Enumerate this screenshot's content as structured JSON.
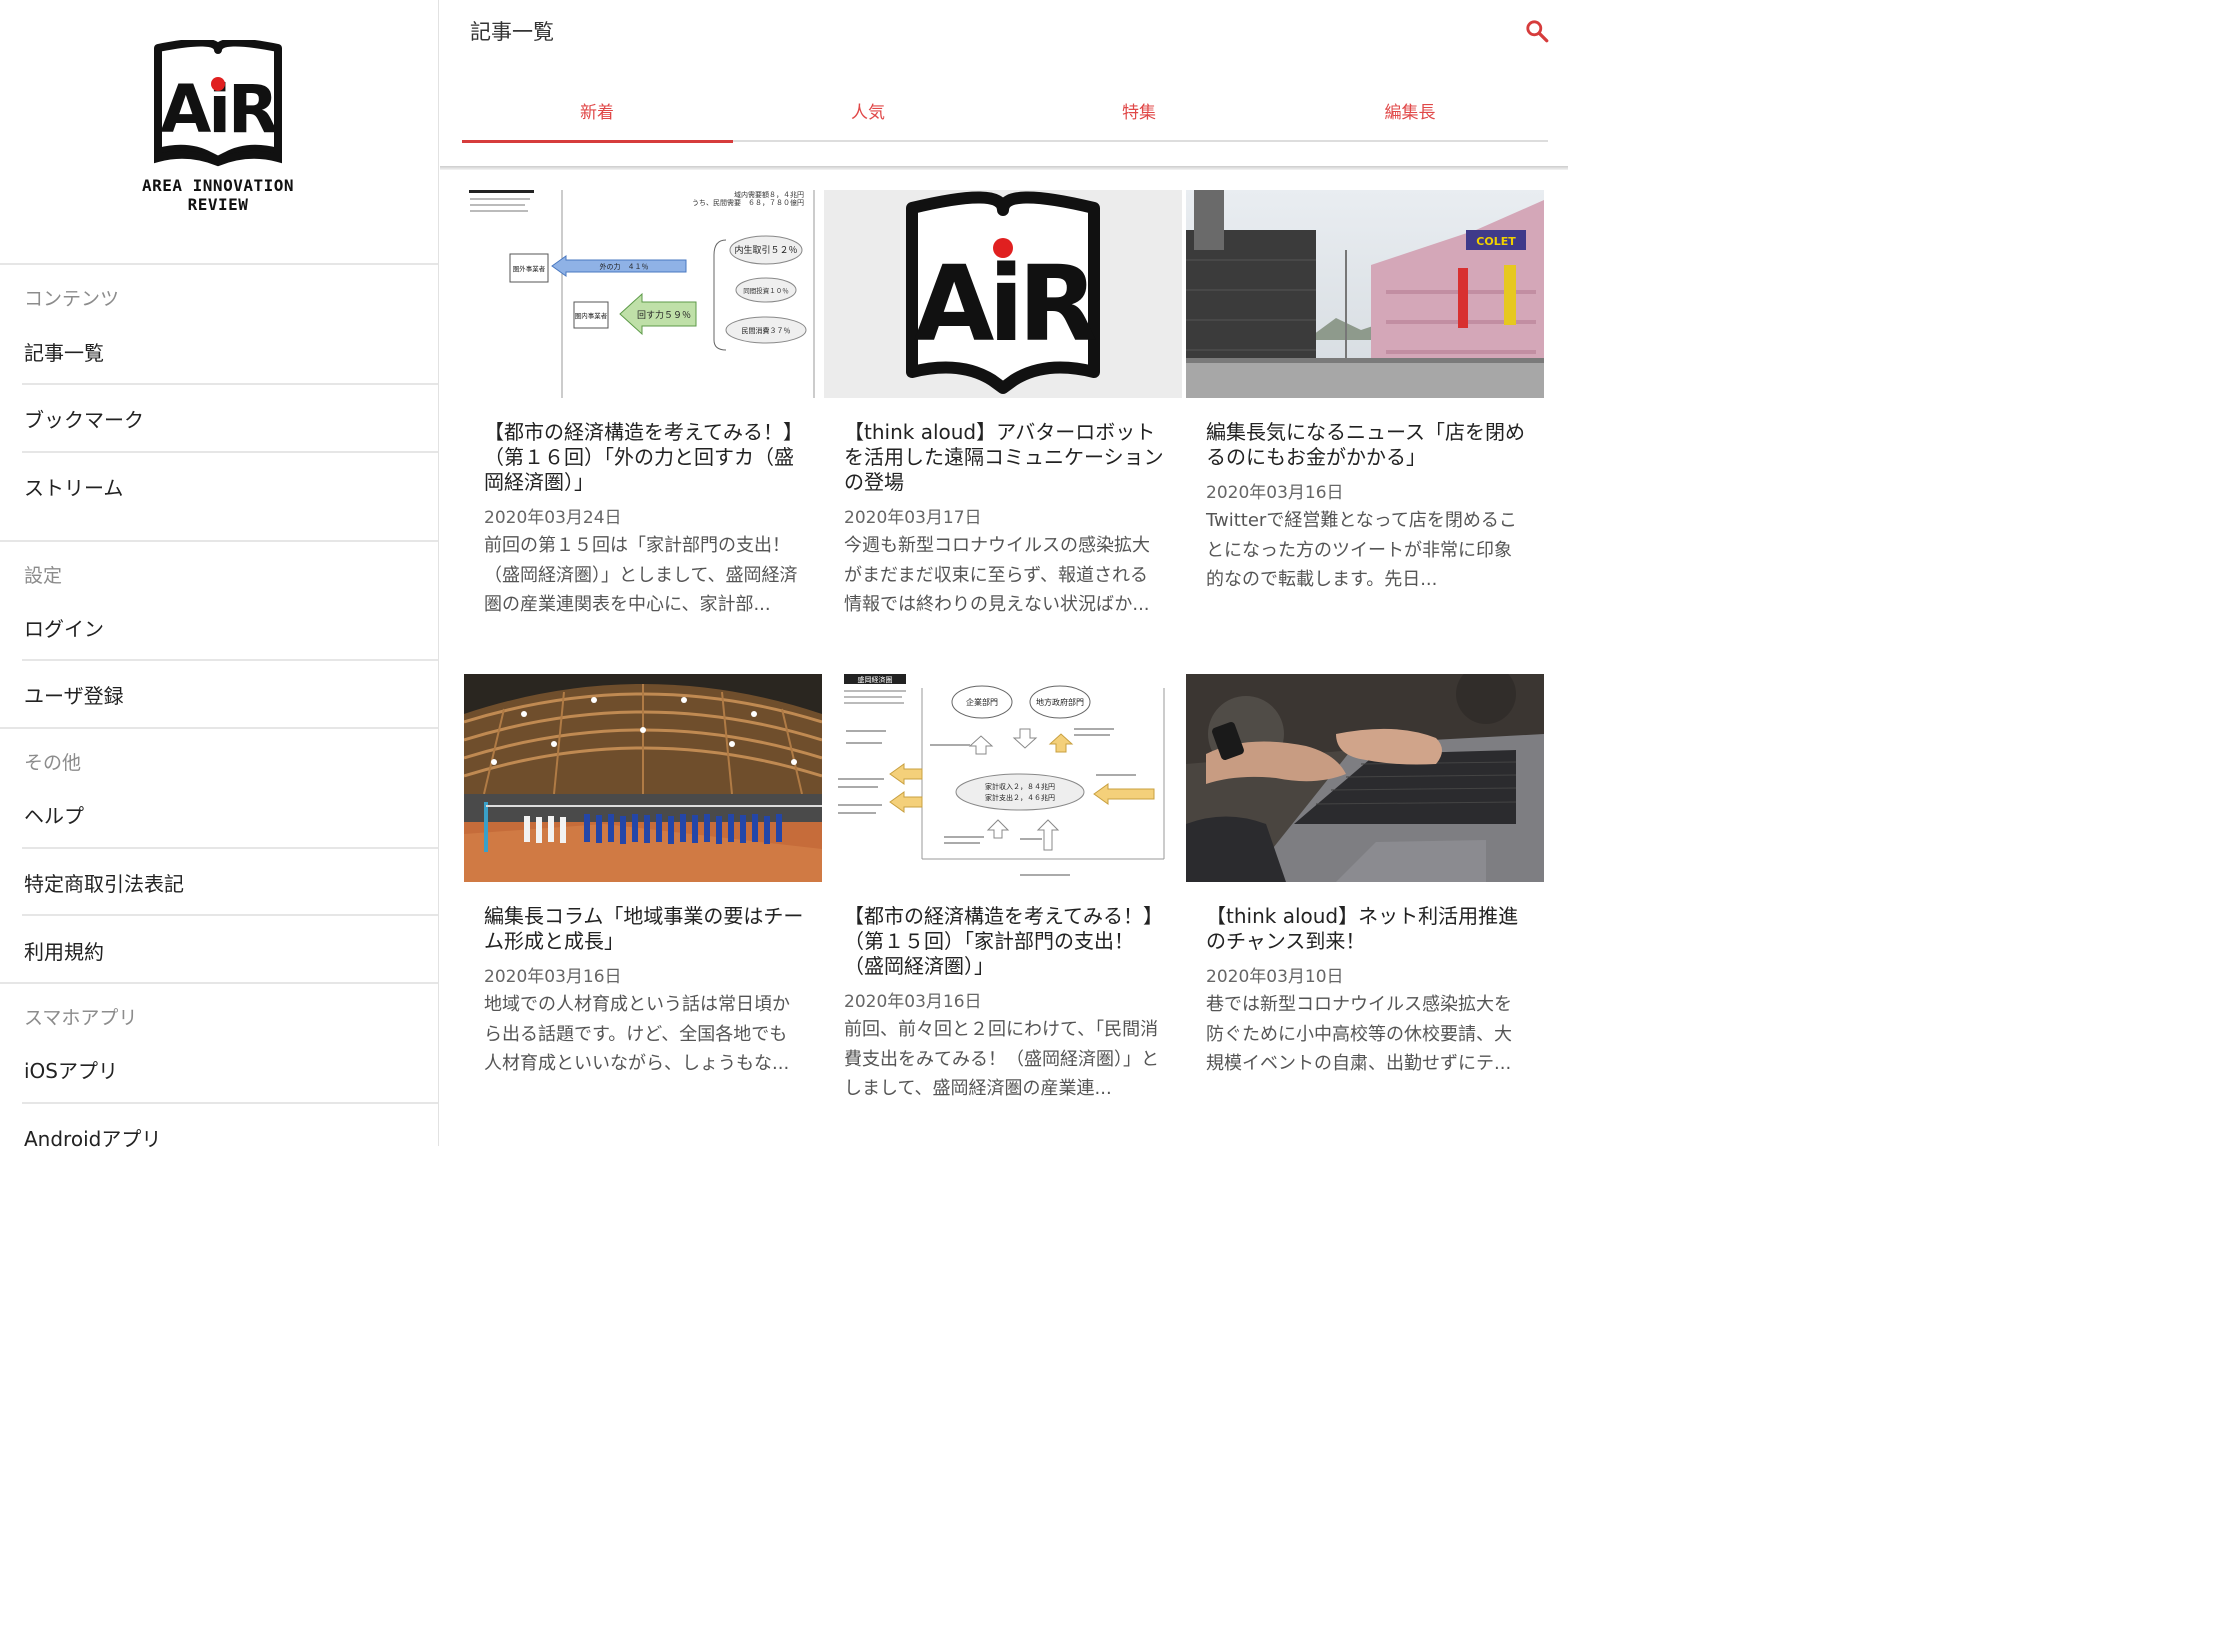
{
  "sidebar": {
    "logo_tagline": "AREA INNOVATION REVIEW",
    "sections": [
      {
        "heading": "コンテンツ",
        "items": [
          "記事一覧",
          "ブックマーク",
          "ストリーム"
        ]
      },
      {
        "heading": "設定",
        "items": [
          "ログイン",
          "ユーザ登録"
        ]
      },
      {
        "heading": "その他",
        "items": [
          "ヘルプ",
          "特定商取引法表記",
          "利用規約"
        ]
      },
      {
        "heading": "スマホアプリ",
        "items": [
          "iOSアプリ",
          "Androidアプリ"
        ]
      }
    ]
  },
  "header": {
    "title": "記事一覧",
    "search_icon": "search-icon",
    "tabs": [
      {
        "label": "新着",
        "active": true
      },
      {
        "label": "人気",
        "active": false
      },
      {
        "label": "特集",
        "active": false
      },
      {
        "label": "編集長",
        "active": false
      }
    ]
  },
  "colors": {
    "accent": "#d63c3c",
    "tab_text": "#e04848",
    "logo_dot": "#e02020"
  },
  "articles": [
    {
      "title": "【都市の経済構造を考えてみる！】（第１６回）「外の力と回すカ（盛岡経済圏）」",
      "date": "2020年03月24日",
      "excerpt": "前回の第１５回は「家計部門の支出！（盛岡経済圏）」としまして、盛岡経済圏の産業連関表を中心に、家計部...",
      "thumb": "economic-flow-diagram",
      "thumb_text": {
        "header_line1": "域内需要額８，４兆円",
        "header_line2": "うち、民間需要　６８，７８０億円",
        "ext_box": "圏外事業者",
        "ext_arrow": "外の力　４１％",
        "int_box": "圏内事業者",
        "int_arrow": "回す力５９％",
        "oval1": "内生取引５２％",
        "oval2": "同間投資１０％",
        "oval3": "民間消費３７％"
      }
    },
    {
      "title": "【think aloud】アバターロボットを活用した遠隔コミュニケーションの登場",
      "date": "2020年03月17日",
      "excerpt": "今週も新型コロナウイルスの感染拡大がまだまだ収束に至らず、報道される情報では終わりの見えない状況ばか...",
      "thumb": "air-logo"
    },
    {
      "title": "編集長気になるニュース「店を閉めるのにもお金がかかる」",
      "date": "2020年03月16日",
      "excerpt": "Twitterで経営難となって店を閉めることになった方のツイートが非常に印象的なので転載します。先日...",
      "thumb": "city-buildings-photo",
      "thumb_text": {
        "store_sign": "COLET"
      }
    },
    {
      "title": "編集長コラム「地域事業の要はチーム形成と成長」",
      "date": "2020年03月16日",
      "excerpt": "地域での人材育成という話は常日頃から出る話題です。けど、全国各地でも人材育成といいながら、しょうもな...",
      "thumb": "volleyball-gym-photo"
    },
    {
      "title": "【都市の経済構造を考えてみる！】（第１５回）「家計部門の支出！（盛岡経済圏）」",
      "date": "2020年03月16日",
      "excerpt": "前回、前々回と２回にわけて、「民間消費支出をみてみる！（盛岡経済圏）」としまして、盛岡経済圏の産業連...",
      "thumb": "household-flow-diagram",
      "thumb_text": {
        "tag": "盛岡経済圏",
        "company": "企業部門",
        "gov": "地方政府部門",
        "center1": "家計収入２，８４兆円",
        "center2": "家計支出２，４６兆円"
      }
    },
    {
      "title": "【think aloud】ネット利活用推進のチャンス到来！",
      "date": "2020年03月10日",
      "excerpt": "巷では新型コロナウイルス感染拡大を防ぐために小中高校等の休校要請、大規模イベントの自粛、出勤せずにテ...",
      "thumb": "laptop-typing-photo"
    }
  ]
}
